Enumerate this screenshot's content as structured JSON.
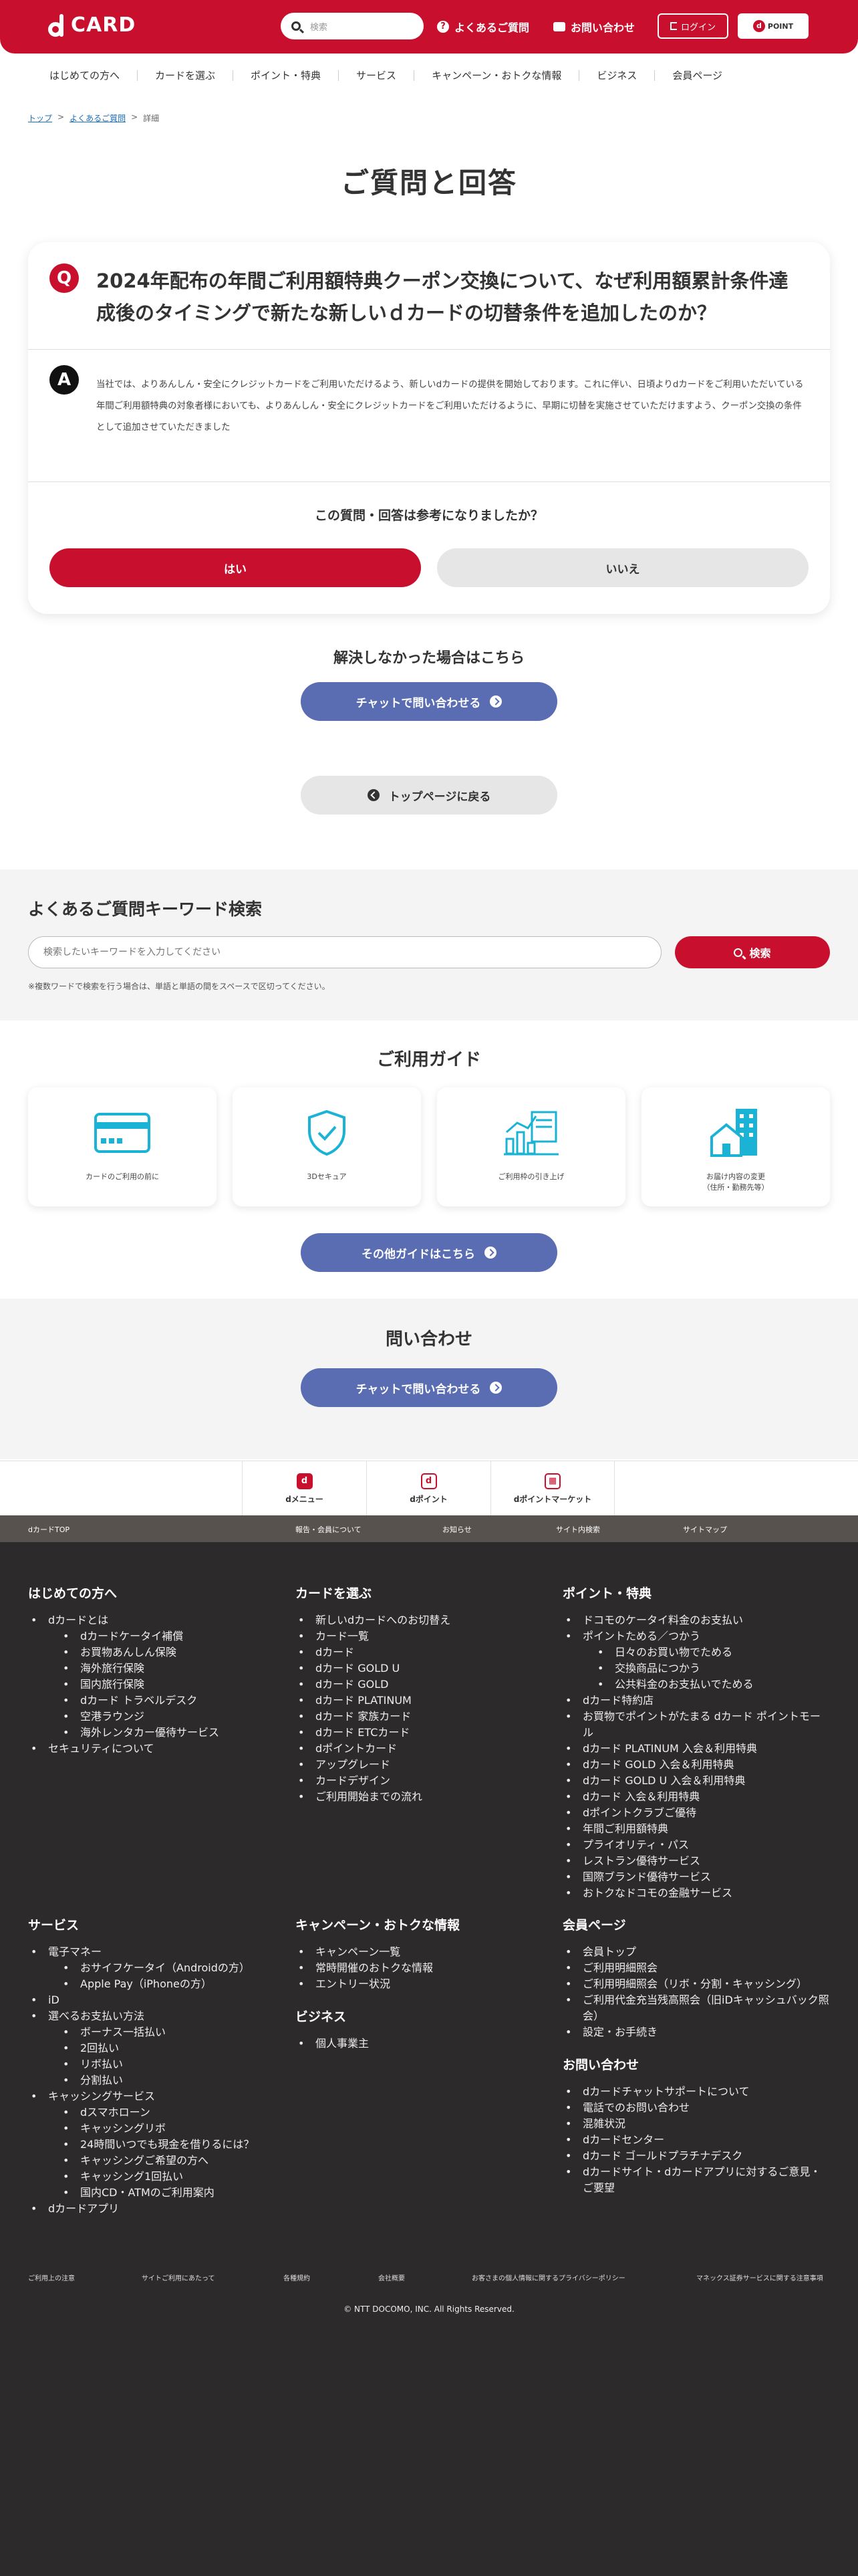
{
  "header": {
    "logo_text": "CARD",
    "search_placeholder": "検索",
    "faq_link": "よくあるご質問",
    "contact_link": "お問い合わせ",
    "login": "ログイン",
    "dpoint": "POINT",
    "accent": "#c8102e"
  },
  "gnav": [
    "はじめての方へ",
    "カードを選ぶ",
    "ポイント・特典",
    "サービス",
    "キャンペーン・おトクな情報",
    "ビジネス",
    "会員ページ"
  ],
  "breadcrumb": {
    "top": "トップ",
    "faq": "よくあるご質問",
    "current": "詳細",
    "sep": ">"
  },
  "page_title": "ご質問と回答",
  "qa": {
    "q_mark": "Q",
    "question": "2024年配布の年間ご利用額特典クーポン交換について、なぜ利用額累計条件達成後のタイミングで新たな新しいｄカードの切替条件を追加したのか？",
    "a_mark": "A",
    "answer": "当社では、よりあんしん・安全にクレジットカードをご利用いただけるよう、新しいdカードの提供を開始しております。これに伴い、日頃よりdカードをご利用いただいている年間ご利用額特典の対象者様においても、よりあんしん・安全にクレジットカードをご利用いただけるように、早期に切替を実施させていただけますよう、クーポン交換の条件として追加させていただきました",
    "helpful_question": "この質問・回答は参考になりましたか？",
    "yes": "はい",
    "no": "いいえ"
  },
  "unresolved": {
    "heading": "解決しなかった場合はこちら",
    "chat_button": "チャットで問い合わせる",
    "top_button": "トップページに戻る"
  },
  "keyword_search": {
    "title": "よくあるご質問キーワード検索",
    "placeholder": "検索したいキーワードを入力してください",
    "button": "検索",
    "note": "※複数ワードで検索を行う場合は、単語と単語の間をスペースで区切ってください。"
  },
  "guide": {
    "title": "ご利用ガイド",
    "cards": [
      {
        "icon": "credit-card-icon",
        "label": "カードのご利用の前に"
      },
      {
        "icon": "shield-check-icon",
        "label": "3Dセキュア"
      },
      {
        "icon": "chart-document-icon",
        "label": "ご利用枠の引き上げ"
      },
      {
        "icon": "building-house-icon",
        "label": "お届け内容の変更",
        "label2": "（住所・勤務先等）"
      }
    ],
    "more_button": "その他ガイドはこちら",
    "icon_color": "#1ab3d6"
  },
  "contact": {
    "title": "問い合わせ",
    "chat_button": "チャットで問い合わせる"
  },
  "services": [
    {
      "mark": "d",
      "label": "dメニュー"
    },
    {
      "mark": "d",
      "label": "dポイント"
    },
    {
      "mark": "▦",
      "label": "dポイントマーケット"
    }
  ],
  "footer_top": [
    "dカードTOP",
    "報告・会員について",
    "お知らせ",
    "サイト内検索",
    "サイトマップ"
  ],
  "footer": {
    "col1": {
      "title": "はじめての方へ",
      "items": [
        {
          "t": "dカードとは",
          "sub": false
        },
        {
          "t": "dカードケータイ補償",
          "sub": true
        },
        {
          "t": "お買物あんしん保険",
          "sub": true
        },
        {
          "t": "海外旅行保険",
          "sub": true
        },
        {
          "t": "国内旅行保険",
          "sub": true
        },
        {
          "t": "dカード トラベルデスク",
          "sub": true
        },
        {
          "t": "空港ラウンジ",
          "sub": true
        },
        {
          "t": "海外レンタカー優待サービス",
          "sub": true
        },
        {
          "t": "セキュリティについて",
          "sub": false
        }
      ]
    },
    "col2": {
      "title": "カードを選ぶ",
      "items": [
        {
          "t": "新しいdカードへのお切替え",
          "sub": false
        },
        {
          "t": "カード一覧",
          "sub": false
        },
        {
          "t": "dカード",
          "sub": false
        },
        {
          "t": "dカード GOLD U",
          "sub": false
        },
        {
          "t": "dカード GOLD",
          "sub": false
        },
        {
          "t": "dカード PLATINUM",
          "sub": false
        },
        {
          "t": "dカード 家族カード",
          "sub": false
        },
        {
          "t": "dカード ETCカード",
          "sub": false
        },
        {
          "t": "dポイントカード",
          "sub": false
        },
        {
          "t": "アップグレード",
          "sub": false
        },
        {
          "t": "カードデザイン",
          "sub": false
        },
        {
          "t": "ご利用開始までの流れ",
          "sub": false
        }
      ]
    },
    "col3": {
      "title": "ポイント・特典",
      "items": [
        {
          "t": "ドコモのケータイ料金のお支払い",
          "sub": false
        },
        {
          "t": "ポイントためる／つかう",
          "sub": false
        },
        {
          "t": "日々のお買い物でためる",
          "sub": true
        },
        {
          "t": "交換商品につかう",
          "sub": true
        },
        {
          "t": "公共料金のお支払いでためる",
          "sub": true
        },
        {
          "t": "dカード特約店",
          "sub": false
        },
        {
          "t": "お買物でポイントがたまる dカード ポイントモール",
          "sub": false
        },
        {
          "t": "dカード PLATINUM 入会＆利用特典",
          "sub": false
        },
        {
          "t": "dカード GOLD 入会＆利用特典",
          "sub": false
        },
        {
          "t": "dカード GOLD U 入会＆利用特典",
          "sub": false
        },
        {
          "t": "dカード 入会＆利用特典",
          "sub": false
        },
        {
          "t": "dポイントクラブご優待",
          "sub": false
        },
        {
          "t": "年間ご利用額特典",
          "sub": false
        },
        {
          "t": "プライオリティ・パス",
          "sub": false
        },
        {
          "t": "レストラン優待サービス",
          "sub": false
        },
        {
          "t": "国際ブランド優待サービス",
          "sub": false
        },
        {
          "t": "おトクなドコモの金融サービス",
          "sub": false
        }
      ]
    },
    "col4": {
      "title": "サービス",
      "items": [
        {
          "t": "電子マネー",
          "sub": false
        },
        {
          "t": "おサイフケータイ（Androidの方）",
          "sub": true
        },
        {
          "t": "Apple Pay（iPhoneの方）",
          "sub": true
        },
        {
          "t": "iD",
          "sub": false
        },
        {
          "t": "選べるお支払い方法",
          "sub": false
        },
        {
          "t": "ボーナス一括払い",
          "sub": true
        },
        {
          "t": "2回払い",
          "sub": true
        },
        {
          "t": "リボ払い",
          "sub": true
        },
        {
          "t": "分割払い",
          "sub": true
        },
        {
          "t": "キャッシングサービス",
          "sub": false
        },
        {
          "t": "dスマホローン",
          "sub": true
        },
        {
          "t": "キャッシングリボ",
          "sub": true
        },
        {
          "t": "24時間いつでも現金を借りるには？",
          "sub": true
        },
        {
          "t": "キャッシングご希望の方へ",
          "sub": true
        },
        {
          "t": "キャッシング1回払い",
          "sub": true
        },
        {
          "t": "国内CD・ATMのご利用案内",
          "sub": true
        },
        {
          "t": "dカードアプリ",
          "sub": false
        }
      ]
    },
    "col5": {
      "title": "キャンペーン・おトクな情報",
      "items": [
        {
          "t": "キャンペーン一覧",
          "sub": false
        },
        {
          "t": "常時開催のおトクな情報",
          "sub": false
        },
        {
          "t": "エントリー状況",
          "sub": false
        }
      ],
      "title2": "ビジネス",
      "items2": [
        {
          "t": "個人事業主",
          "sub": false
        }
      ]
    },
    "col6": {
      "title": "会員ページ",
      "items": [
        {
          "t": "会員トップ",
          "sub": false
        },
        {
          "t": "ご利用明細照会",
          "sub": false
        },
        {
          "t": "ご利用明細照会（リボ・分割・キャッシング）",
          "sub": false
        },
        {
          "t": "ご利用代金充当残高照会（旧iDキャッシュバック照会）",
          "sub": false
        },
        {
          "t": "設定・お手続き",
          "sub": false
        }
      ],
      "title2": "お問い合わせ",
      "items2": [
        {
          "t": "dカードチャットサポートについて",
          "sub": false
        },
        {
          "t": "電話でのお問い合わせ",
          "sub": false
        },
        {
          "t": "混雑状況",
          "sub": false
        },
        {
          "t": "dカードセンター",
          "sub": false
        },
        {
          "t": "dカード ゴールドプラチナデスク",
          "sub": false
        },
        {
          "t": "dカードサイト・dカードアプリに対するご意見・ご要望",
          "sub": false
        }
      ]
    },
    "bottom_links": [
      "ご利用上の注意",
      "サイトご利用にあたって",
      "各種規約",
      "会社概要",
      "お客さまの個人情報に関するプライバシーポリシー",
      "マネックス証券サービスに関する注意事項"
    ],
    "copyright": "© NTT DOCOMO, INC. All Rights Reserved."
  }
}
